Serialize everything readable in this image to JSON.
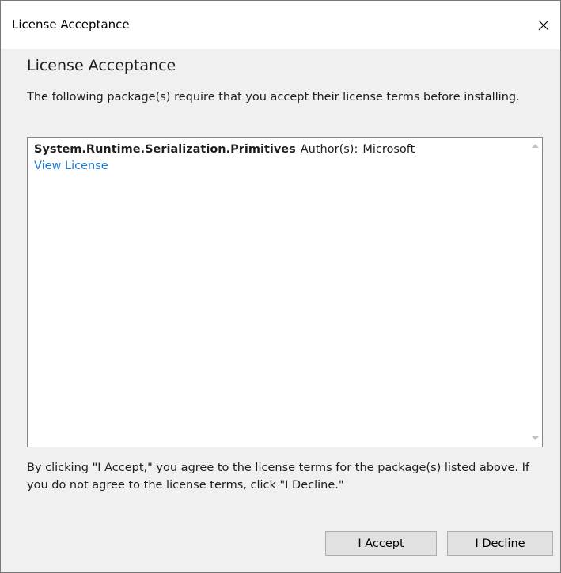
{
  "window": {
    "title": "License Acceptance",
    "close_icon": "close-icon"
  },
  "header": {
    "heading": "License Acceptance",
    "description": "The following package(s) require that you accept their license terms before installing."
  },
  "packages": [
    {
      "name": "System.Runtime.Serialization.Primitives",
      "author_label": "Author(s):",
      "author": "Microsoft",
      "link_label": "View License"
    }
  ],
  "footer": {
    "text": "By clicking \"I Accept,\" you agree to the license terms for the package(s) listed above. If you do not agree to the license terms, click \"I Decline.\""
  },
  "buttons": {
    "accept_label": "I Accept",
    "decline_label": "I Decline"
  },
  "colors": {
    "link": "#1e7ad6",
    "dialog_background": "#f0f0f0",
    "titlebar_background": "#ffffff"
  }
}
